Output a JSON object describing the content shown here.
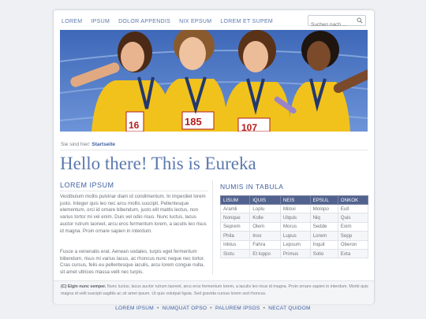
{
  "nav": {
    "items": [
      "LOREM",
      "IPSUM",
      "DOLOR APPENDIS",
      "NIX EPSUM",
      "LOREM ET SUPEM"
    ]
  },
  "search": {
    "placeholder": "Suchen nach ..."
  },
  "hero": {
    "bibs": [
      "185",
      "107",
      "16"
    ],
    "icon": "team-photo"
  },
  "breadcrumb": {
    "label": "Sie sind hier:",
    "current": "Startseite"
  },
  "title": "Hello there! This is Eureka",
  "left": {
    "heading": "LOREM IPSUM",
    "para1": "Vestibulum mollis pulvinar diam id condimentum. In imperdiet lorem justo. Integer quis leo nec arcu mollis suscipit. Pellentesque elementum, orci id ornare bibendum, justo elit mattis lectus, non varius tortor mi vel enim. Duis vel odio risus. Nunc luctus, lacus auctor rutrum laoreet, arcu eros fermentum lorem, a iaculis leo risus id magna. Proin ornare sapien in interdum.",
    "para2": "Fusce a venenatis erat. Aenean sodales, turpis eget fermentum bibendum, risus mi varius lacus, ac rhoncus nunc neque nec tortor. Cras cursus, felis eu pellentesque iaculis, arcu lorem congue nulla, sit amet ultrices massa velit nec turpis."
  },
  "right": {
    "heading": "NUMIS IN TABULA",
    "columns": [
      "LISUM",
      "IQUIS",
      "NEIS",
      "EPSUL",
      "ONKOK"
    ],
    "rows": [
      [
        "Aramli",
        "Loplu",
        "Miloxi",
        "Molopo",
        "Eull"
      ],
      [
        "Nonque",
        "Kolle",
        "Ulquis",
        "Niq",
        "Quis"
      ],
      [
        "Seprem",
        "Olem",
        "Morus",
        "Sedde",
        "Exim"
      ],
      [
        "Phila",
        "Inxx",
        "Lupus",
        "Lorem",
        "Sepp"
      ],
      [
        "Inktus",
        "Fahra",
        "Lepsum",
        "Inquit",
        "Oberon"
      ],
      [
        "Sixtu",
        "Et loppo",
        "Primus",
        "Solio",
        "Exta"
      ]
    ]
  },
  "footer": {
    "bold": "(C) Elgin nunc semper.",
    "text": " Nunc luctus, lacus auctor rutrum laoreet, arcu eros fermentum lorem, a iaculis leo risus id magna. Proin ornare sapien in interdum. Morbi quis magna id velit suscipit sagittis ac sit amet ipsum. Ut quis volutpat ligula. Sed gravida cursus lorem sed rhoncus."
  },
  "bottom_nav": {
    "items": [
      "LOREM IPSUM",
      "NUMQUAT OPSO",
      "PALUREM IPSOS",
      "NECAT QUIDOM"
    ],
    "separator": "•"
  },
  "colors": {
    "accent": "#5b79ad",
    "table_header": "#51628e",
    "track_blue": "#5a80c8"
  }
}
